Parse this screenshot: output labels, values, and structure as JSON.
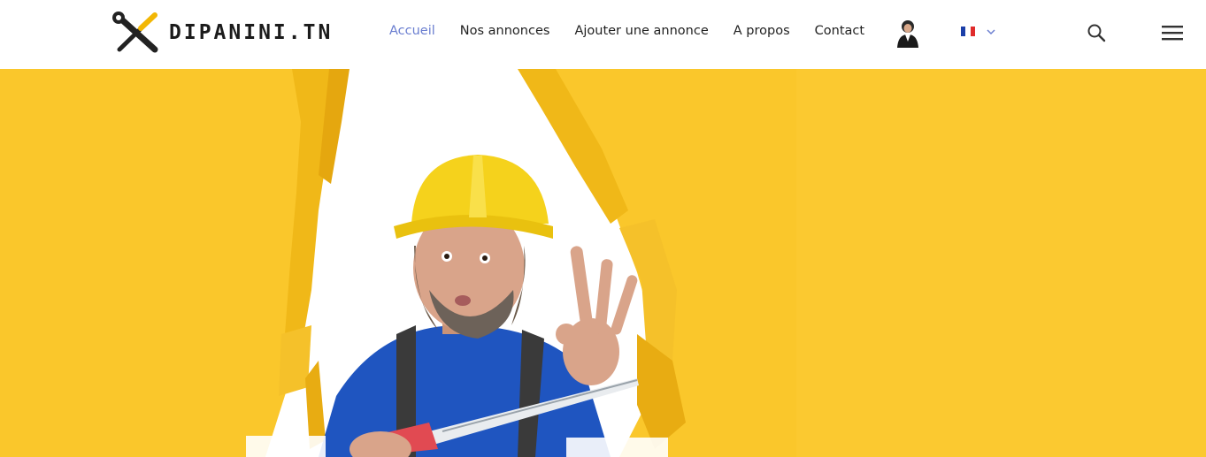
{
  "brand": {
    "name": "DIPANINI.TN",
    "logo_icon": "wrench-screwdriver-icon"
  },
  "nav": {
    "items": [
      {
        "label": "Accueil",
        "active": true
      },
      {
        "label": "Nos annonces",
        "active": false
      },
      {
        "label": "Ajouter une annonce",
        "active": false
      },
      {
        "label": "A propos",
        "active": false
      },
      {
        "label": "Contact",
        "active": false
      }
    ]
  },
  "user": {
    "avatar_icon": "user-avatar-icon"
  },
  "language": {
    "flag": "french-flag-icon",
    "dropdown_icon": "chevron-down-icon"
  },
  "actions": {
    "search_icon": "search-icon",
    "menu_icon": "hamburger-menu-icon"
  },
  "hero": {
    "image": "worker-in-hard-hat-through-torn-yellow-paper"
  },
  "colors": {
    "accent": "#6a7ed0",
    "hero_bg": "#fac72b",
    "text": "#222222",
    "helmet": "#f5d21c",
    "shirt": "#1f55c0"
  }
}
